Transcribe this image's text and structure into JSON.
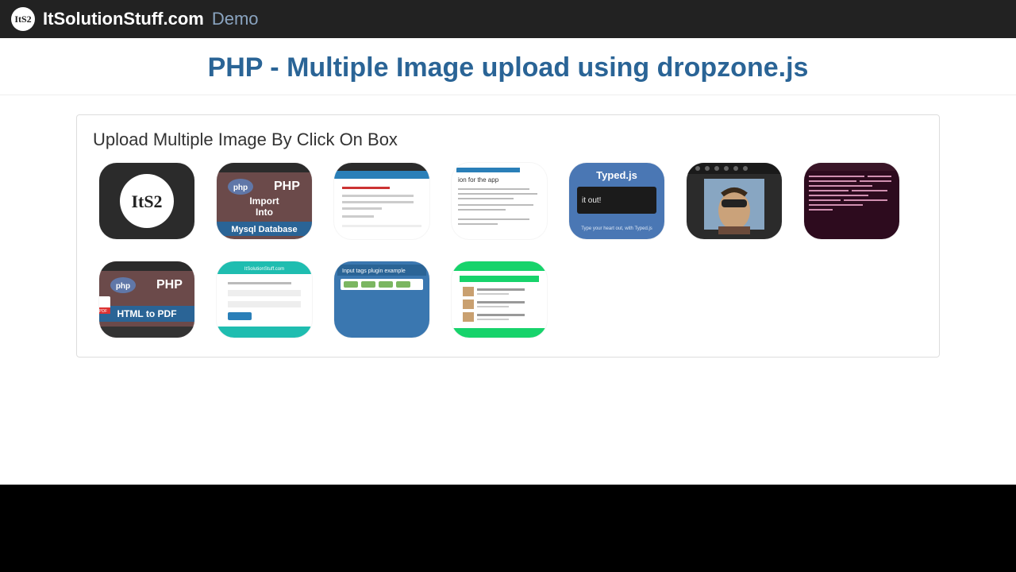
{
  "header": {
    "logo_text": "ItS2",
    "brand": "ItSolutionStuff.com",
    "brand_sub": "Demo"
  },
  "page": {
    "title": "PHP - Multiple Image upload using dropzone.js"
  },
  "panel": {
    "title": "Upload Multiple Image By Click On Box"
  },
  "thumbs": [
    {
      "kind": "its2-logo",
      "label": "ItS2"
    },
    {
      "kind": "php-import",
      "line1": "PHP",
      "line2": "Import",
      "line3": "Into",
      "line4": "Mysql Database"
    },
    {
      "kind": "form-light"
    },
    {
      "kind": "app-doc",
      "caption": "ion for the app"
    },
    {
      "kind": "typedjs",
      "title": "Typed.js",
      "sub": "it out!",
      "footer": "Type your heart out, with Typed.js"
    },
    {
      "kind": "photo-face"
    },
    {
      "kind": "terminal"
    },
    {
      "kind": "php-html2pdf",
      "line1": "PHP",
      "line2": "HTML to PDF"
    },
    {
      "kind": "teal-form"
    },
    {
      "kind": "input-tags",
      "caption": "Input tags plugin example"
    },
    {
      "kind": "green-list"
    }
  ]
}
